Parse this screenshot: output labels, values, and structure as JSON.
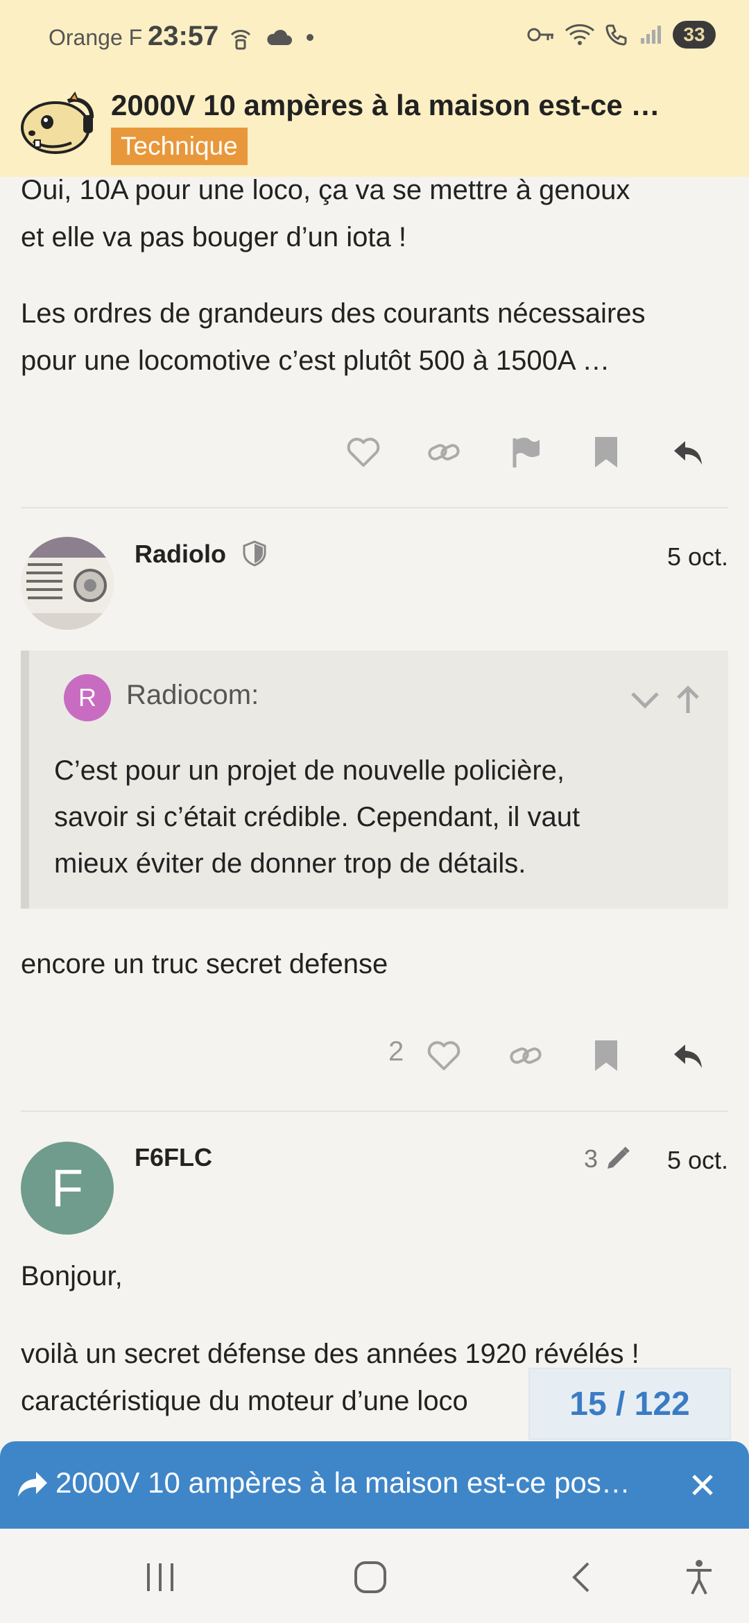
{
  "status_bar": {
    "carrier": "Orange F",
    "time": "23:57",
    "battery": "33"
  },
  "header": {
    "title": "2000V 10 ampères à la maison est-ce …",
    "category": "Technique"
  },
  "post_prev": {
    "p1_line1": "Oui, 10A pour une loco, ça va se mettre à genoux",
    "p1_line2": "et elle va pas bouger d’un iota !",
    "p2_line1": "Les ordres de grandeurs des courants nécessaires",
    "p2_line2": "pour une locomotive c’est plutôt 500 à 1500A …"
  },
  "post_radiolo": {
    "username": "Radiolo",
    "date": "5 oct.",
    "quote": {
      "avatar_letter": "R",
      "name": "Radiocom:",
      "line1": "C’est pour un projet de nouvelle policière,",
      "line2": "savoir si c’était crédible. Cependant, il vaut",
      "line3": "mieux éviter de donner trop de détails."
    },
    "body": "encore un truc secret defense",
    "like_count": "2"
  },
  "post_f6flc": {
    "avatar_letter": "F",
    "username": "F6FLC",
    "edit_count": "3",
    "date": "5 oct.",
    "line1": "Bonjour,",
    "line2": "voilà un secret défense des années 1920 révélés !",
    "line3": "caractéristique du moteur d’une loco"
  },
  "progress": {
    "label": "15 / 122"
  },
  "banner": {
    "text": "2000V 10 ampères à la maison est-ce pos…"
  },
  "colors": {
    "header_bg": "#fcefc3",
    "category": "#e8983a",
    "banner": "#3f86c8",
    "counter_text": "#3a7bc4"
  }
}
